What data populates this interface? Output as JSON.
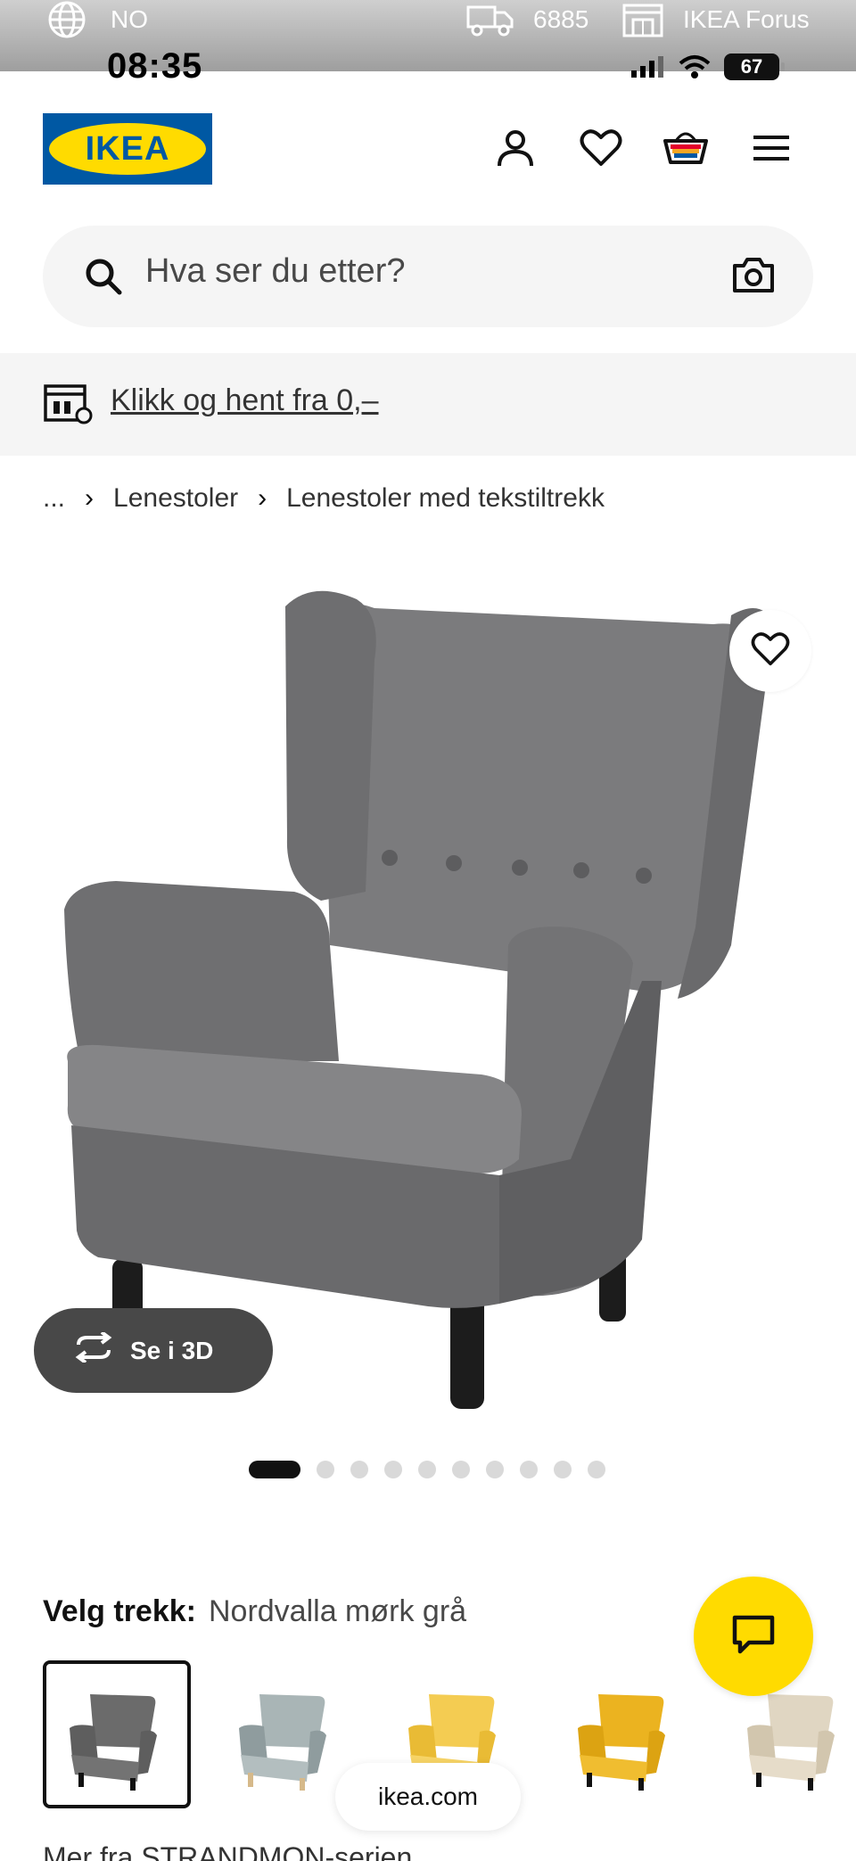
{
  "statusbar": {
    "region": "NO",
    "postcode": "6885",
    "store": "IKEA Forus",
    "time": "08:35",
    "battery": "67"
  },
  "header": {
    "logo_text": "IKEA",
    "brand_blue": "#0058a3",
    "brand_yellow": "#ffdb00"
  },
  "search": {
    "placeholder": "Hva ser du etter?"
  },
  "promo": {
    "text": "Klikk og hent fra 0,–"
  },
  "breadcrumb": {
    "items": [
      "...",
      "Lenestoler",
      "Lenestoler med tekstiltrekk"
    ]
  },
  "gallery": {
    "see_3d_label": "Se i 3D",
    "image_count": 10,
    "active_index": 0
  },
  "variant": {
    "label": "Velg trekk:",
    "value": "Nordvalla mørk grå",
    "swatches": [
      {
        "name": "Nordvalla mørk grå",
        "color": "#6b6b6b",
        "selected": true
      },
      {
        "name": "checked",
        "color": "#9aa6a8",
        "selected": false
      },
      {
        "name": "yellow-1",
        "color": "#f2c542",
        "selected": false
      },
      {
        "name": "yellow-2",
        "color": "#e8b21f",
        "selected": false
      },
      {
        "name": "beige",
        "color": "#ddd2bd",
        "selected": false
      }
    ]
  },
  "browser": {
    "url": "ikea.com"
  },
  "footer": {
    "more_text": "Mer fra STRANDMON-serien"
  }
}
